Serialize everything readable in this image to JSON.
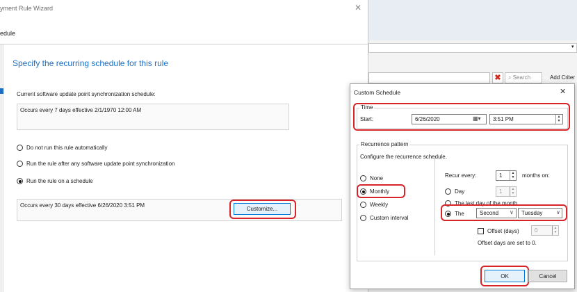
{
  "wizard": {
    "title": "yment Rule Wizard",
    "page_name": "edule",
    "heading": "Specify the recurring schedule for this rule",
    "sync_label": "Current software update point synchronization schedule:",
    "sync_value": "Occurs every 7 days effective 2/1/1970 12:00 AM",
    "options": [
      {
        "label": "Do not run this rule automatically",
        "selected": false
      },
      {
        "label": "Run the rule after any software update point synchronization",
        "selected": false
      },
      {
        "label": "Run the rule on a schedule",
        "selected": true
      }
    ],
    "schedule_value": "Occurs every 30 days effective 6/26/2020 3:51 PM",
    "customize_label": "Customize..."
  },
  "console": {
    "search_label": "Search",
    "add_criteria": "Add Criter"
  },
  "dialog": {
    "title": "Custom Schedule",
    "time_group": "Time",
    "start_label": "Start:",
    "start_date": "6/26/2020",
    "start_time": "3:51 PM",
    "recurrence_group": "Recurrence pattern",
    "configure_text": "Configure the recurrence schedule.",
    "patterns": [
      {
        "label": "None",
        "selected": false
      },
      {
        "label": "Monthly",
        "selected": true
      },
      {
        "label": "Weekly",
        "selected": false
      },
      {
        "label": "Custom interval",
        "selected": false
      }
    ],
    "recur_every_label": "Recur every:",
    "recur_every_value": "1",
    "months_on": "months on:",
    "day_label": "Day",
    "day_value": "1",
    "last_day_label": "The last day of the month",
    "the_label": "The",
    "week_select": "Second",
    "day_select": "Tuesday",
    "offset_label": "Offset (days)",
    "offset_value": "0",
    "offset_note": "Offset days are set to 0.",
    "ok_label": "OK",
    "cancel_label": "Cancel"
  },
  "colors": {
    "accent_blue": "#1c6fc4",
    "highlight_red": "#d6242a"
  }
}
